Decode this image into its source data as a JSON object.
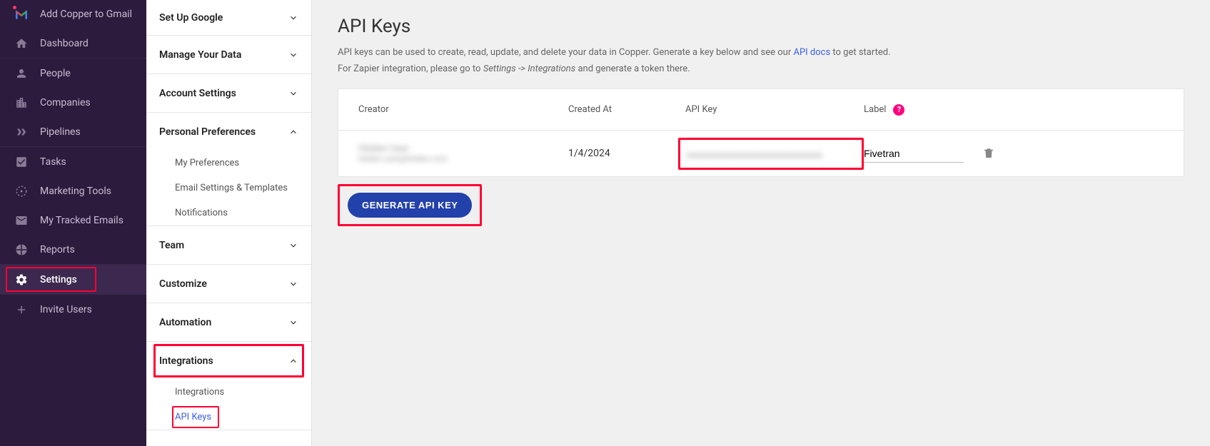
{
  "nav": {
    "gmail": "Add Copper to Gmail",
    "items": [
      {
        "label": "Dashboard",
        "icon": "home"
      },
      {
        "label": "People",
        "icon": "person"
      },
      {
        "label": "Companies",
        "icon": "company"
      },
      {
        "label": "Pipelines",
        "icon": "pipeline"
      },
      {
        "label": "Tasks",
        "icon": "task"
      },
      {
        "label": "Marketing Tools",
        "icon": "marketing"
      },
      {
        "label": "My Tracked Emails",
        "icon": "email"
      },
      {
        "label": "Reports",
        "icon": "reports"
      },
      {
        "label": "Settings",
        "icon": "settings",
        "active": true
      },
      {
        "label": "Invite Users",
        "icon": "plus"
      }
    ]
  },
  "sub": {
    "sections": [
      {
        "title": "Set Up Google",
        "expanded": false
      },
      {
        "title": "Manage Your Data",
        "expanded": false
      },
      {
        "title": "Account Settings",
        "expanded": false
      },
      {
        "title": "Personal Preferences",
        "expanded": true,
        "items": [
          "My Preferences",
          "Email Settings & Templates",
          "Notifications"
        ]
      },
      {
        "title": "Team",
        "expanded": false
      },
      {
        "title": "Customize",
        "expanded": false
      },
      {
        "title": "Automation",
        "expanded": false
      },
      {
        "title": "Integrations",
        "expanded": true,
        "items": [
          "Integrations",
          "API Keys"
        ],
        "highlighted": true,
        "activeItem": "API Keys"
      }
    ]
  },
  "page": {
    "title": "API Keys",
    "desc_1a": "API keys can be used to create, read, update, and delete your data in Copper. Generate a key below and see our ",
    "desc_1_link": "API docs",
    "desc_1b": " to get started.",
    "desc_2a": "For Zapier integration, please go to ",
    "desc_2_italic": "Settings -> Integrations",
    "desc_2b": " and generate a token there.",
    "columns": {
      "creator": "Creator",
      "created": "Created At",
      "key": "API Key",
      "label": "Label"
    },
    "row": {
      "creator_name": "Hidden User",
      "creator_email": "hidden.user@hidden.com",
      "created_at": "1/4/2024",
      "api_key": "xxxxxxxxxxxxxxxxxxxxxxxxxxxxxxxxxxx",
      "label": "Fivetran"
    },
    "generate_button": "GENERATE API KEY"
  }
}
